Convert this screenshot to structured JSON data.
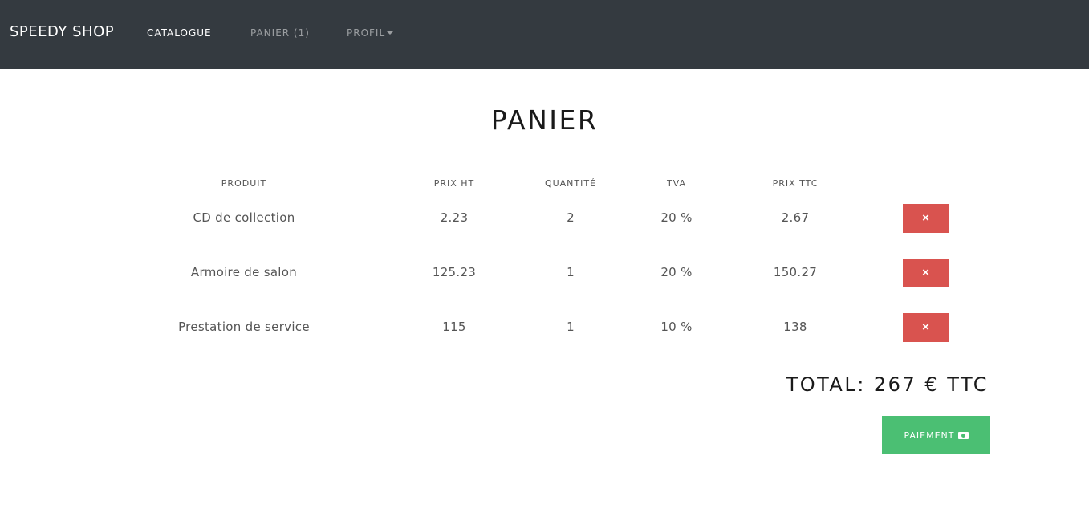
{
  "nav": {
    "brand": "SPEEDY SHOP",
    "links": [
      "CATALOGUE",
      "PANIER (1)",
      "PROFIL"
    ]
  },
  "page": {
    "title": "PANIER"
  },
  "table": {
    "headers": [
      "PRODUIT",
      "PRIX HT",
      "QUANTITÉ",
      "TVA",
      "PRIX TTC"
    ],
    "rows": [
      [
        "CD de collection",
        "2.23",
        "2",
        "20 %",
        "2.67"
      ],
      [
        "Armoire de salon",
        "125.23",
        "1",
        "20 %",
        "150.27"
      ],
      [
        "Prestation de service",
        "115",
        "1",
        "10 %",
        "138"
      ]
    ],
    "remove_label": "×"
  },
  "summary": {
    "total": "TOTAL: 267 € TTC",
    "pay_label": "PAIEMENT"
  },
  "colors": {
    "navbar": "#343a40",
    "danger": "#d9534f",
    "success": "#4bbf73"
  },
  "icons": {
    "remove": "close-icon",
    "pay": "money-icon",
    "profil_dropdown": "caret-down-icon"
  }
}
